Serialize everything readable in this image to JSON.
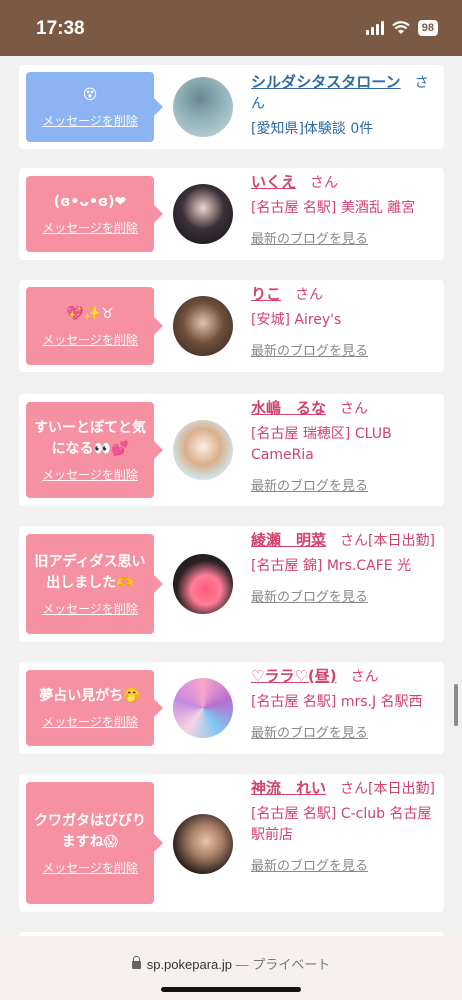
{
  "status": {
    "time": "17:38",
    "battery": "98"
  },
  "delete_label": "メッセージを削除",
  "blog_label": "最新のブログを見る",
  "san": "さん",
  "cards": [
    {
      "message": "😵",
      "name": "シルダシタスタローン",
      "detail": "[愛知県]体験談 0件"
    },
    {
      "message": "(ɞ•ᴗ•ɞ)❤",
      "name": "いくえ",
      "detail": "[名古屋 名駅] 美酒乱 離宮"
    },
    {
      "message": "💖✨♉",
      "name": "りこ",
      "detail": "[安城] Airey's"
    },
    {
      "message": "すいーとぽてと気になる👀💕",
      "name": "水嶋　るな",
      "detail": "[名古屋 瑞穂区] CLUB CameRia"
    },
    {
      "message": "旧アディダス思い出しました🫶",
      "name": "綾瀬　明菜",
      "name_suffix": "[本日出勤]",
      "detail": "[名古屋 錦] Mrs.CAFE 光"
    },
    {
      "message": "夢占い見がち🤭",
      "name": "♡ララ♡(昼)",
      "detail": "[名古屋 名駅] mrs.J 名駅西"
    },
    {
      "message": "クワガタはびびりますね😱",
      "name": "神流　れい",
      "name_suffix": "[本日出勤]",
      "detail": "[名古屋 名駅] C-club 名古屋駅前店"
    }
  ],
  "browser": {
    "url": "sp.pokepara.jp",
    "separator": "—",
    "mode": "プライベート"
  }
}
